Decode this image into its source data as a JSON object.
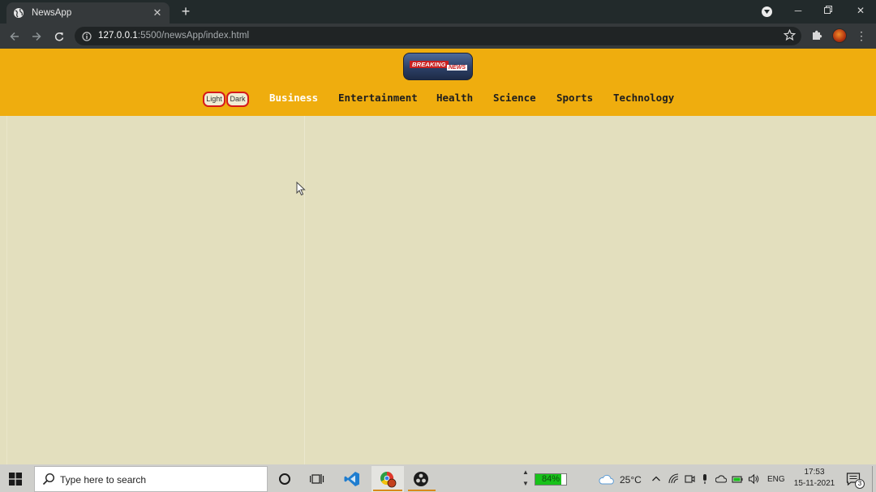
{
  "browser": {
    "tab": {
      "title": "NewsApp"
    },
    "url": {
      "host": "127.0.0.1",
      "path": ":5500/newsApp/index.html"
    }
  },
  "site": {
    "logo": {
      "line1": "BREAKING",
      "line2": "NEWS"
    },
    "theme": {
      "light_label": "Light",
      "dark_label": "Dark"
    },
    "categories": [
      {
        "label": "Business",
        "active": true
      },
      {
        "label": "Entertainment",
        "active": false
      },
      {
        "label": "Health",
        "active": false
      },
      {
        "label": "Science",
        "active": false
      },
      {
        "label": "Sports",
        "active": false
      },
      {
        "label": "Technology",
        "active": false
      }
    ],
    "colors": {
      "header": "#efad0e",
      "background": "#e3dfbe",
      "active_category": "#ffffff",
      "theme_border": "#d61a1a"
    }
  },
  "taskbar": {
    "search_placeholder": "Type here to search",
    "battery": {
      "percent": 84,
      "label": "84%"
    },
    "temperature": "25°C",
    "language": "ENG",
    "time": "17:53",
    "date": "15-11-2021",
    "notifications": "3"
  }
}
